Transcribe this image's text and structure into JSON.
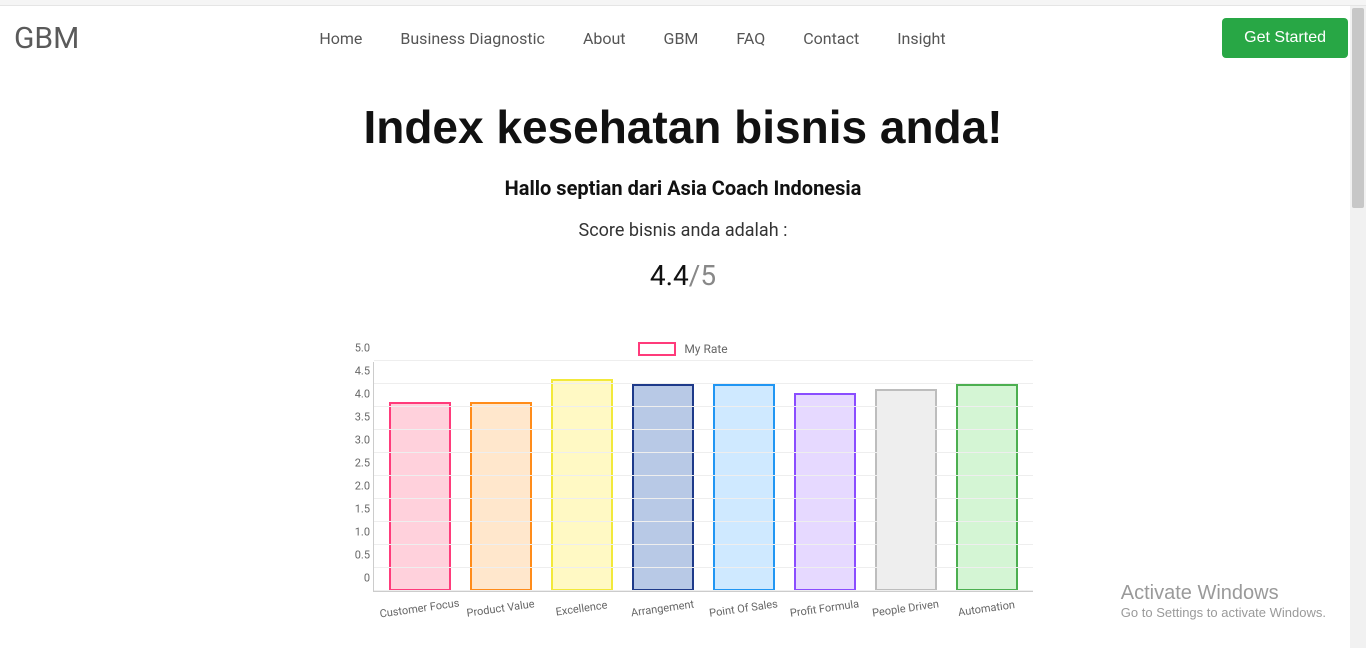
{
  "brand": "GBM",
  "nav": {
    "items": [
      "Home",
      "Business Diagnostic",
      "About",
      "GBM",
      "FAQ",
      "Contact",
      "Insight"
    ],
    "cta": "Get Started"
  },
  "page": {
    "title": "Index kesehatan bisnis anda!",
    "subtitle": "Hallo septian dari Asia Coach Indonesia",
    "score_label": "Score bisnis anda adalah :",
    "score_value": "4.4",
    "score_max": "/5"
  },
  "chart_data": {
    "type": "bar",
    "legend": "My Rate",
    "ylim": [
      0,
      5
    ],
    "yticks": [
      0,
      0.5,
      1.0,
      1.5,
      2.0,
      2.5,
      3.0,
      3.5,
      4.0,
      4.5,
      5.0
    ],
    "categories": [
      "Customer Focus",
      "Product Value",
      "Excellence",
      "Arrangement",
      "Point Of Sales",
      "Profit Formula",
      "People Driven",
      "Automation"
    ],
    "values": [
      4.1,
      4.1,
      4.6,
      4.5,
      4.5,
      4.3,
      4.4,
      4.5
    ],
    "colors": [
      {
        "fill": "#ffd1dc",
        "stroke": "#ff3b7b"
      },
      {
        "fill": "#ffe7cc",
        "stroke": "#ff8c1a"
      },
      {
        "fill": "#fff9c4",
        "stroke": "#f2e93a"
      },
      {
        "fill": "#b8c9e6",
        "stroke": "#1e3a8a"
      },
      {
        "fill": "#cfe9ff",
        "stroke": "#2196f3"
      },
      {
        "fill": "#e6d9ff",
        "stroke": "#8a4dff"
      },
      {
        "fill": "#eeeeee",
        "stroke": "#bdbdbd"
      },
      {
        "fill": "#d4f5d4",
        "stroke": "#4caf50"
      }
    ]
  },
  "watermark": {
    "line1": "Activate Windows",
    "line2": "Go to Settings to activate Windows."
  }
}
